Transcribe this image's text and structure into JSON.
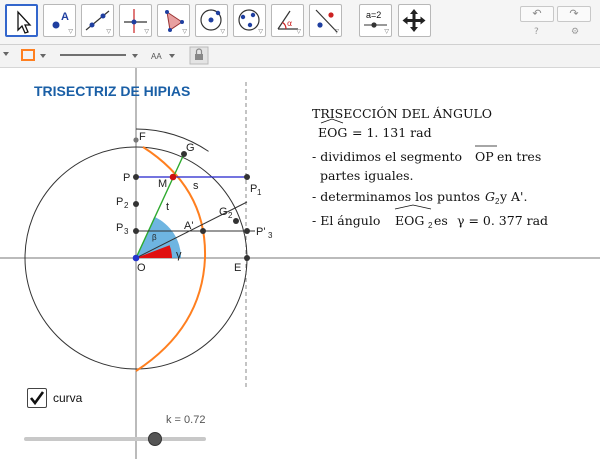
{
  "toolbar": {
    "tools": [
      {
        "icon": "move-arrow-icon",
        "selected": true
      },
      {
        "icon": "point-icon",
        "label": "A"
      },
      {
        "icon": "line-icon"
      },
      {
        "icon": "perpendicular-line-icon"
      },
      {
        "icon": "polygon-icon"
      },
      {
        "icon": "circle-center-point-icon"
      },
      {
        "icon": "circle-three-points-icon"
      },
      {
        "icon": "angle-icon",
        "label": "α"
      },
      {
        "icon": "reflect-icon"
      },
      {
        "icon": "slider-tool-icon",
        "label": "a=2"
      },
      {
        "icon": "move-graphics-view-icon"
      }
    ],
    "undo_symbol": "↶",
    "redo_symbol": "↷",
    "help_symbol": "?",
    "settings_symbol": "⚙"
  },
  "stylebar": {
    "font_size_label": "AA",
    "lock_symbol": "🔒"
  },
  "graphics": {
    "title": "TRISECTRIZ DE HIPIAS",
    "description": {
      "line1": "TRISECCIÓN DEL ÁNGULO",
      "angle_name": "EOG",
      "angle_value": " = 1. 131 rad",
      "line3": "- dividimos el segmento ",
      "segment_name": "OP",
      "line3_end": " en tres",
      "line4": "partes iguales.",
      "line5_start": "- determinamos los puntos  ",
      "line5_point": "G",
      "line5_sub": "2",
      "line5_end": " y A'.",
      "line6_start": "- El ángulo ",
      "angle2_name": "EOG",
      "angle2_sub": "2",
      "line6_mid": " es ",
      "gamma": "γ = 0. 377 rad"
    },
    "points": {
      "F": "F",
      "G": "G",
      "P": "P",
      "M": "M",
      "s": "s",
      "P1": "P",
      "P1_sub": "1",
      "P2": "P",
      "P2_sub": "2",
      "t": "t",
      "G2": "G",
      "G2_sub": "2",
      "P3": "P",
      "P3_sub": "3",
      "A1": "A'",
      "P3p": "P'",
      "P3p_sub": "3",
      "beta": "β",
      "gamma": "γ",
      "O": "O",
      "E": "E"
    },
    "colors": {
      "arc": "#ff7f1f",
      "line_s": "#2222cc",
      "line_t": "#2eaa2e",
      "sector_beta": "#4aa3d9",
      "sector_gamma": "#e01010",
      "point_m": "#cc1010",
      "grid_axis": "#777777"
    }
  },
  "checkbox": {
    "label": "curva",
    "checked": true
  },
  "slider": {
    "label": "k = 0.72",
    "value": 0.72,
    "min": 0,
    "max": 1
  }
}
